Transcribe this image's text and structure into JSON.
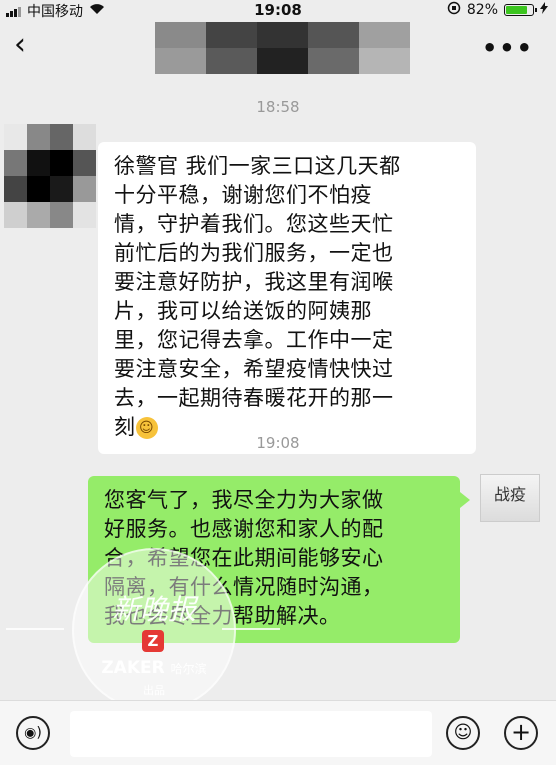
{
  "status": {
    "carrier": "中国移动",
    "time": "19:08",
    "battery": "82%",
    "battery_level": 0.82
  },
  "nav": {
    "back_icon": "chevron-left-icon",
    "back_glyph": "‹",
    "more_glyph": "•••"
  },
  "messages": [
    {
      "timestamp": "18:58",
      "lines": [
        "徐警官 我们一家三口这几天都",
        "十分平稳，谢谢您们不怕疫",
        "情，守护着我们。您这些天忙",
        "前忙后的为我们服务，一定也",
        "要注意好防护，我这里有润喉",
        "片，我可以给送饭的阿姨那",
        "里，您记得去拿。工作中一定",
        "要注意安全，希望疫情快快过",
        "去，一起期待春暖花开的那一",
        "刻"
      ],
      "emoji": "☺"
    },
    {
      "timestamp": "19:08",
      "lines": [
        "您客气了，我尽全力为大家做",
        "好服务。也感谢您和家人的配",
        "合，希望您在此期间能够安心",
        "隔离，有什么情况随时沟通，",
        "我也会尽全力帮助解决。"
      ],
      "avatar_text": "战疫"
    }
  ],
  "watermark": {
    "script": "新晚报",
    "logo_letter": "Z",
    "brand": "ZAKER",
    "city": "哈尔滨",
    "sub": "出品"
  },
  "input_bar": {
    "voice_glyph": "◉)",
    "emoji_glyph": "☺",
    "plus_glyph": "+"
  },
  "colors": {
    "background": "#ededed",
    "outgoing_bubble": "#95ec69",
    "incoming_bubble": "#ffffff",
    "battery": "#3cc51f"
  }
}
